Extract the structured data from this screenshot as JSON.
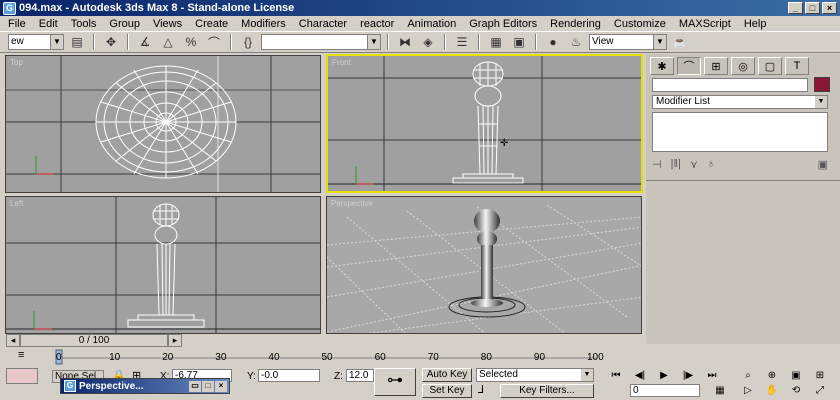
{
  "window": {
    "title": "094.max - Autodesk 3ds Max 8 - Stand-alone License",
    "logo": "G"
  },
  "menu": [
    "File",
    "Edit",
    "Tools",
    "Group",
    "Views",
    "Create",
    "Modifiers",
    "Character",
    "reactor",
    "Animation",
    "Graph Editors",
    "Rendering",
    "Customize",
    "MAXScript",
    "Help"
  ],
  "toolbar": {
    "selection_filter": "ew",
    "named_selection": "",
    "view_dropdown": "View"
  },
  "viewports": {
    "top": {
      "label": "Top"
    },
    "front": {
      "label": "Front"
    },
    "left": {
      "label": "Left"
    },
    "perspective": {
      "label": "Perspective"
    }
  },
  "command_panel": {
    "modifier_list": "Modifier List",
    "object_color": "#8a1538"
  },
  "timeslider": {
    "frame_label": "0 / 100"
  },
  "trackbar": {
    "ticks": [
      "0",
      "10",
      "20",
      "30",
      "40",
      "50",
      "60",
      "70",
      "80",
      "90",
      "100"
    ]
  },
  "status": {
    "selection_text": "None Sel",
    "mini_window_title": "Perspective...",
    "x_label": "X:",
    "x_value": "-6.77",
    "y_label": "Y:",
    "y_value": "-0.0",
    "z_label": "Z:",
    "z_value": "12.0",
    "auto_key": "Auto Key",
    "set_key": "Set Key",
    "key_mode": "Selected",
    "key_filters": "Key Filters...",
    "current_frame": "0"
  }
}
